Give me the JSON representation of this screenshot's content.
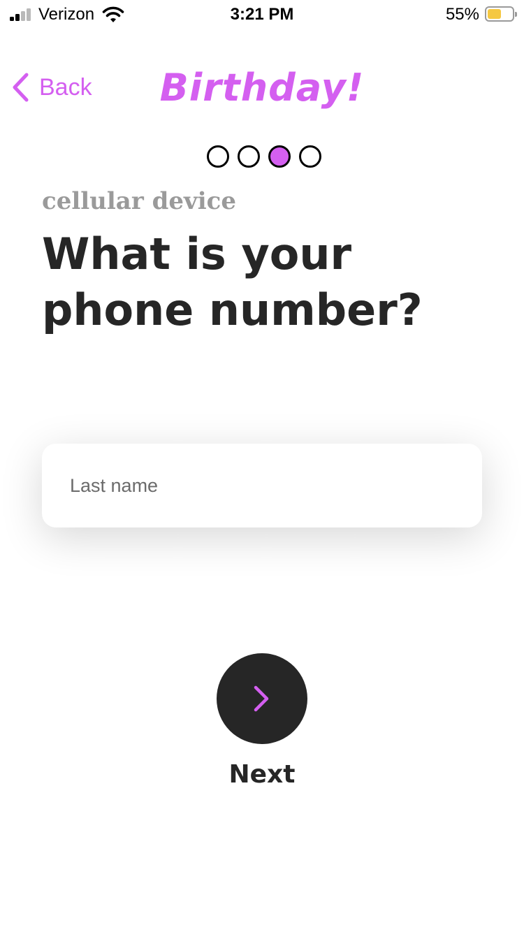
{
  "status_bar": {
    "carrier": "Verizon",
    "time": "3:21 PM",
    "battery_percent_label": "55%",
    "battery_level": 0.55,
    "battery_color": "#f5c842",
    "signal_bars_filled": 2,
    "signal_bars_total": 4,
    "icons": [
      "signal-icon",
      "wifi-icon",
      "battery-icon"
    ]
  },
  "nav": {
    "back_label": "Back",
    "back_icon": "chevron-left-icon",
    "logo_text": "Birthday!"
  },
  "progress": {
    "total_steps": 4,
    "current_step": 3
  },
  "content": {
    "eyebrow": "cellular device",
    "title": "What is your phone number?"
  },
  "form": {
    "field_value": "",
    "field_placeholder": "Last name"
  },
  "footer": {
    "next_label": "Next",
    "next_icon": "chevron-right-icon"
  },
  "colors": {
    "accent": "#d45ff0",
    "dark": "#262626",
    "muted": "#9a9a9a"
  }
}
